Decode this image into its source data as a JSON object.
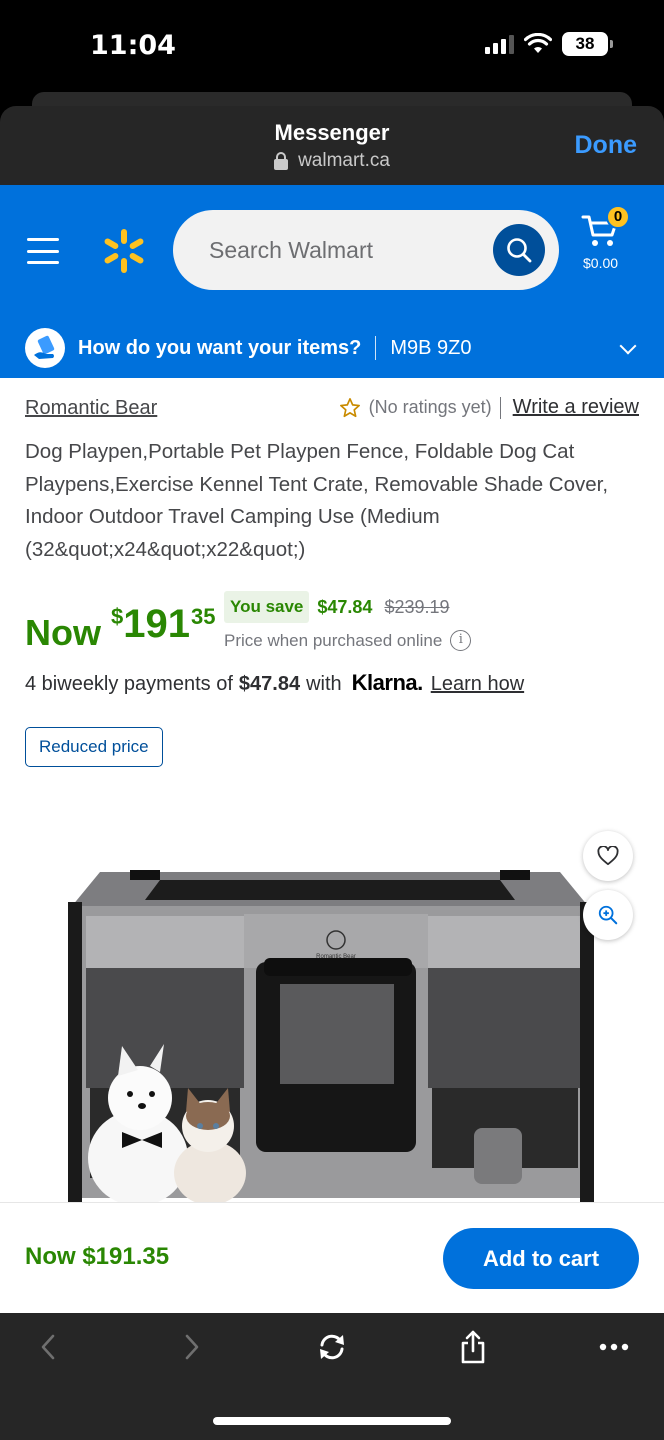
{
  "status_bar": {
    "time": "11:04",
    "battery": "38"
  },
  "browser_header": {
    "title": "Messenger",
    "url": "walmart.ca",
    "done_label": "Done"
  },
  "walmart_header": {
    "search_placeholder": "Search Walmart",
    "cart_count": "0",
    "cart_total": "$0.00",
    "brand_color": "#0071dc",
    "spark_color": "#ffc220"
  },
  "delivery": {
    "question": "How do you want your items?",
    "postal_code": "M9B 9Z0"
  },
  "product": {
    "brand": "Romantic Bear",
    "rating_text": "(No ratings yet)",
    "write_review": "Write a review",
    "title": "Dog Playpen,Portable Pet Playpen Fence, Foldable Dog Cat Playpens,Exercise Kennel Tent Crate, Removable Shade Cover, Indoor Outdoor Travel Camping Use (Medium (32&quot;x24&quot;x22&quot;)",
    "price": {
      "now_label": "Now",
      "currency": "$",
      "dollars": "191",
      "cents": "35",
      "you_save_label": "You save",
      "save_amount": "$47.84",
      "was_price": "$239.19",
      "note": "Price when purchased online",
      "price_color": "#2a8703"
    },
    "klarna": {
      "prefix": "4 biweekly payments of",
      "amount": "$47.84",
      "with": "with",
      "logo": "Klarna.",
      "learn_how": "Learn how"
    },
    "badge": "Reduced price",
    "image_label": "Romantic Bear"
  },
  "bottom_bar": {
    "price": "Now $191.35",
    "add_to_cart": "Add to cart"
  },
  "toolbar": {
    "icons": [
      "back-icon",
      "forward-icon",
      "reload-icon",
      "share-icon",
      "more-icon"
    ]
  }
}
